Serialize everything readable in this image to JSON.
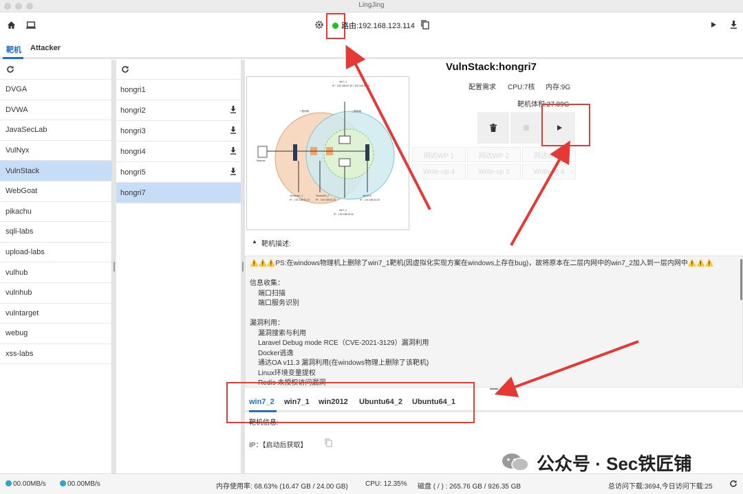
{
  "window": {
    "title": "LingJing"
  },
  "toolbar": {
    "route_label": "路由:192.168.123.114",
    "status_color": "#1ec21e"
  },
  "tabs": [
    {
      "label": "靶机",
      "active": true
    },
    {
      "label": "Attacker",
      "active": false
    }
  ],
  "categories": [
    {
      "label": "DVGA"
    },
    {
      "label": "DVWA"
    },
    {
      "label": "JavaSecLab"
    },
    {
      "label": "VulNyx"
    },
    {
      "label": "VulnStack",
      "selected": true
    },
    {
      "label": "WebGoat"
    },
    {
      "label": "pikachu"
    },
    {
      "label": "sqli-labs"
    },
    {
      "label": "upload-labs"
    },
    {
      "label": "vulhub"
    },
    {
      "label": "vulnhub"
    },
    {
      "label": "vulntarget"
    },
    {
      "label": "webug"
    },
    {
      "label": "xss-labs"
    }
  ],
  "targets": [
    {
      "label": "hongri1",
      "download": false
    },
    {
      "label": "hongri2",
      "download": true
    },
    {
      "label": "hongri3",
      "download": true
    },
    {
      "label": "hongri4",
      "download": true
    },
    {
      "label": "hongri5",
      "download": true
    },
    {
      "label": "hongri7",
      "download": false,
      "selected": true
    }
  ],
  "detail": {
    "title": "VulnStack:hongri7",
    "config_label": "配置需求",
    "cpu": "CPU:7核",
    "memory": "内存:9G",
    "size": "靶机体积:27.89G",
    "wp_buttons": [
      "网达WP 1",
      "网达WP 2",
      "网达WP 3",
      "Write-up 4",
      "Write-up 5",
      "Write-up 6"
    ],
    "diagram": {
      "left_zone": "一层内网",
      "right_zone": "二层内网",
      "attacker": "Attacker",
      "top_node": "win7_1",
      "top_node_ip": "IP：192.168.52.30 / 192.168.93.20",
      "bottom_nodes": [
        {
          "name": "Ubuntu64_1",
          "ip": "IP：192.168.52.10"
        },
        {
          "name": "Ubuntu64_2",
          "ip": "IP：192.168.52.20"
        },
        {
          "name": "win2012",
          "ip": "IP：192.168.93.30"
        }
      ],
      "bottom_node": "win7_2",
      "bottom_node_ip": "IP：192.168.93.40"
    },
    "desc_heading": "靶机描述:",
    "desc_lines": [
      {
        "text": "⚠️⚠️⚠️PS:在windows物理机上删除了win7_1靶机(因虚拟化实现方案在windows上存在bug)，故将原本在二层内网中的win7_2加入到一层内网中⚠️⚠️⚠️",
        "indent": false
      },
      {
        "text": "",
        "indent": false
      },
      {
        "text": "信息收集：",
        "indent": false
      },
      {
        "text": "端口扫描",
        "indent": true
      },
      {
        "text": "端口服务识别",
        "indent": true
      },
      {
        "text": "",
        "indent": false
      },
      {
        "text": "漏洞利用：",
        "indent": false
      },
      {
        "text": "漏洞搜索与利用",
        "indent": true
      },
      {
        "text": "Laravel Debug mode RCE（CVE-2021-3129）漏洞利用",
        "indent": true
      },
      {
        "text": "Docker逃逸",
        "indent": true
      },
      {
        "text": "通达OA v11.3 漏洞利用(在windows物理上删除了该靶机)",
        "indent": true
      },
      {
        "text": "Linux环境变量提权",
        "indent": true
      },
      {
        "text": "Redis 未授权访问漏洞",
        "indent": true
      }
    ],
    "host_tabs": [
      {
        "label": "win7_2",
        "active": true
      },
      {
        "label": "win7_1",
        "active": false
      },
      {
        "label": "win2012",
        "active": false
      },
      {
        "label": "Ubuntu64_2",
        "active": false
      },
      {
        "label": "Ubuntu64_1",
        "active": false
      }
    ],
    "host_info_label": "靶机信息:",
    "ip_label": "IP：【启动后获取】"
  },
  "statusbar": {
    "upload": "00.00MB/s",
    "download": "00.00MB/s",
    "memory": "内存使用率: 68.63% (16.47 GB / 24.00 GB)",
    "cpu": "CPU: 12.35%",
    "disk": "磁盘 ( / ) : 265.76 GB / 926.35 GB",
    "visits": "总访问下载:3694,今日访问下载:25"
  },
  "watermark": "公众号 · Sec铁匠铺"
}
